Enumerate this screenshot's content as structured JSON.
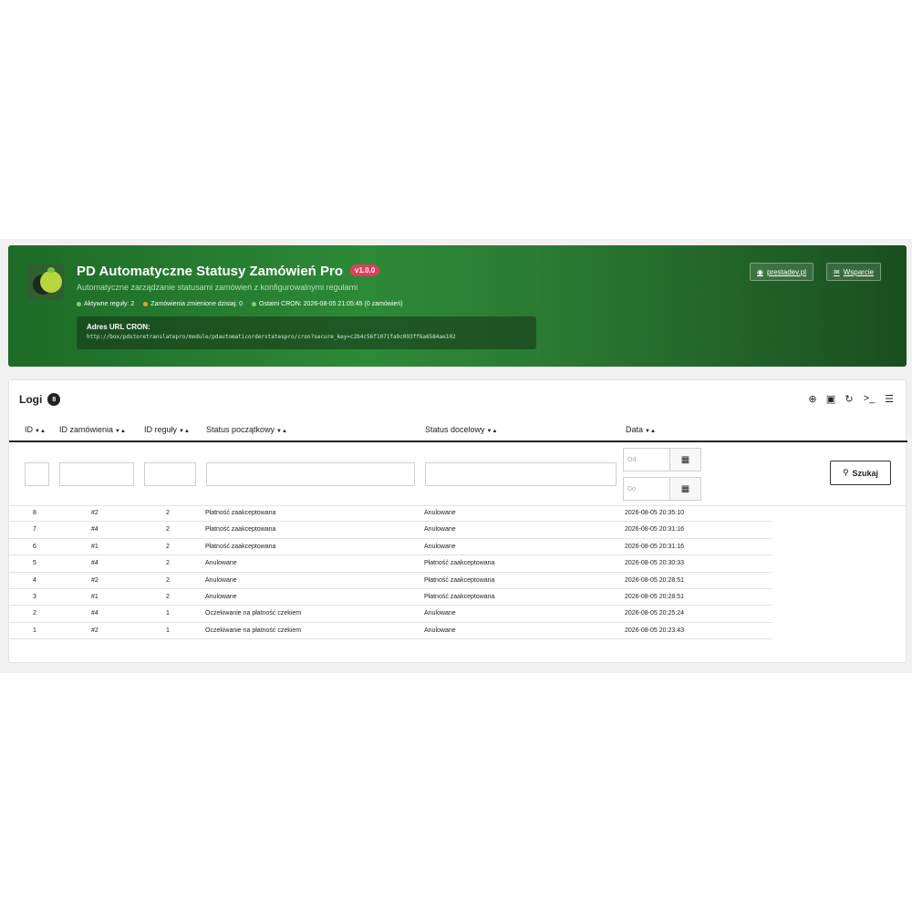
{
  "header": {
    "title": "PD Automatyczne Statusy Zamówień Pro",
    "version": "v1.0.0",
    "subtitle": "Automatyczne zarządzanie statusami zamówień z konfigurowalnymi regułami",
    "stats": [
      {
        "label": "Aktywne reguły: 2",
        "color": "#7dd36f"
      },
      {
        "label": "Zamówienia zmienione dzisiaj: 0",
        "color": "#f0a020"
      },
      {
        "label": "Ostatni CRON: 2026-08-05 21:05:45 (0 zamówień)",
        "color": "#7dd36f"
      }
    ],
    "cron_label": "Adres URL CRON:",
    "cron_url": "http://box/pdstoretranslatepro/module/pdautomaticorderstatespro/cron?secure_key=c2b4c56f1071fa9c093ff6a6584ae102",
    "btn_prestadev": "prestadev.pl",
    "btn_support": "Wsparcie"
  },
  "logs": {
    "title": "Logi",
    "count": "8",
    "columns": [
      "ID",
      "ID zamówienia",
      "ID reguły",
      "Status początkowy",
      "Status docelowy",
      "Data"
    ],
    "date_from_placeholder": "Od",
    "date_to_placeholder": "Do",
    "search_label": "Szukaj",
    "rows": [
      {
        "id": "8",
        "order": "#2",
        "rule": "2",
        "from": "Płatność zaakceptowana",
        "to": "Anulowane",
        "date": "2026-08-05 20:35:10"
      },
      {
        "id": "7",
        "order": "#4",
        "rule": "2",
        "from": "Płatność zaakceptowana",
        "to": "Anulowane",
        "date": "2026-08-05 20:31:16"
      },
      {
        "id": "6",
        "order": "#1",
        "rule": "2",
        "from": "Płatność zaakceptowana",
        "to": "Anulowane",
        "date": "2026-08-05 20:31:16"
      },
      {
        "id": "5",
        "order": "#4",
        "rule": "2",
        "from": "Anulowane",
        "to": "Płatność zaakceptowana",
        "date": "2026-08-05 20:30:33"
      },
      {
        "id": "4",
        "order": "#2",
        "rule": "2",
        "from": "Anulowane",
        "to": "Płatność zaakceptowana",
        "date": "2026-08-05 20:28:51"
      },
      {
        "id": "3",
        "order": "#1",
        "rule": "2",
        "from": "Anulowane",
        "to": "Płatność zaakceptowana",
        "date": "2026-08-05 20:28:51"
      },
      {
        "id": "2",
        "order": "#4",
        "rule": "1",
        "from": "Oczekiwanie na płatność czekiem",
        "to": "Anulowane",
        "date": "2026-08-05 20:25:24"
      },
      {
        "id": "1",
        "order": "#2",
        "rule": "1",
        "from": "Oczekiwanie na płatność czekiem",
        "to": "Anulowane",
        "date": "2026-08-05 20:23:43"
      }
    ]
  },
  "icons": {
    "globe": "globe-icon",
    "envelope": "envelope-icon",
    "add": "plus-circle-icon",
    "export": "export-icon",
    "refresh": "refresh-icon",
    "sql": "terminal-icon",
    "database": "database-icon",
    "calendar": "calendar-icon",
    "search": "search-icon"
  }
}
